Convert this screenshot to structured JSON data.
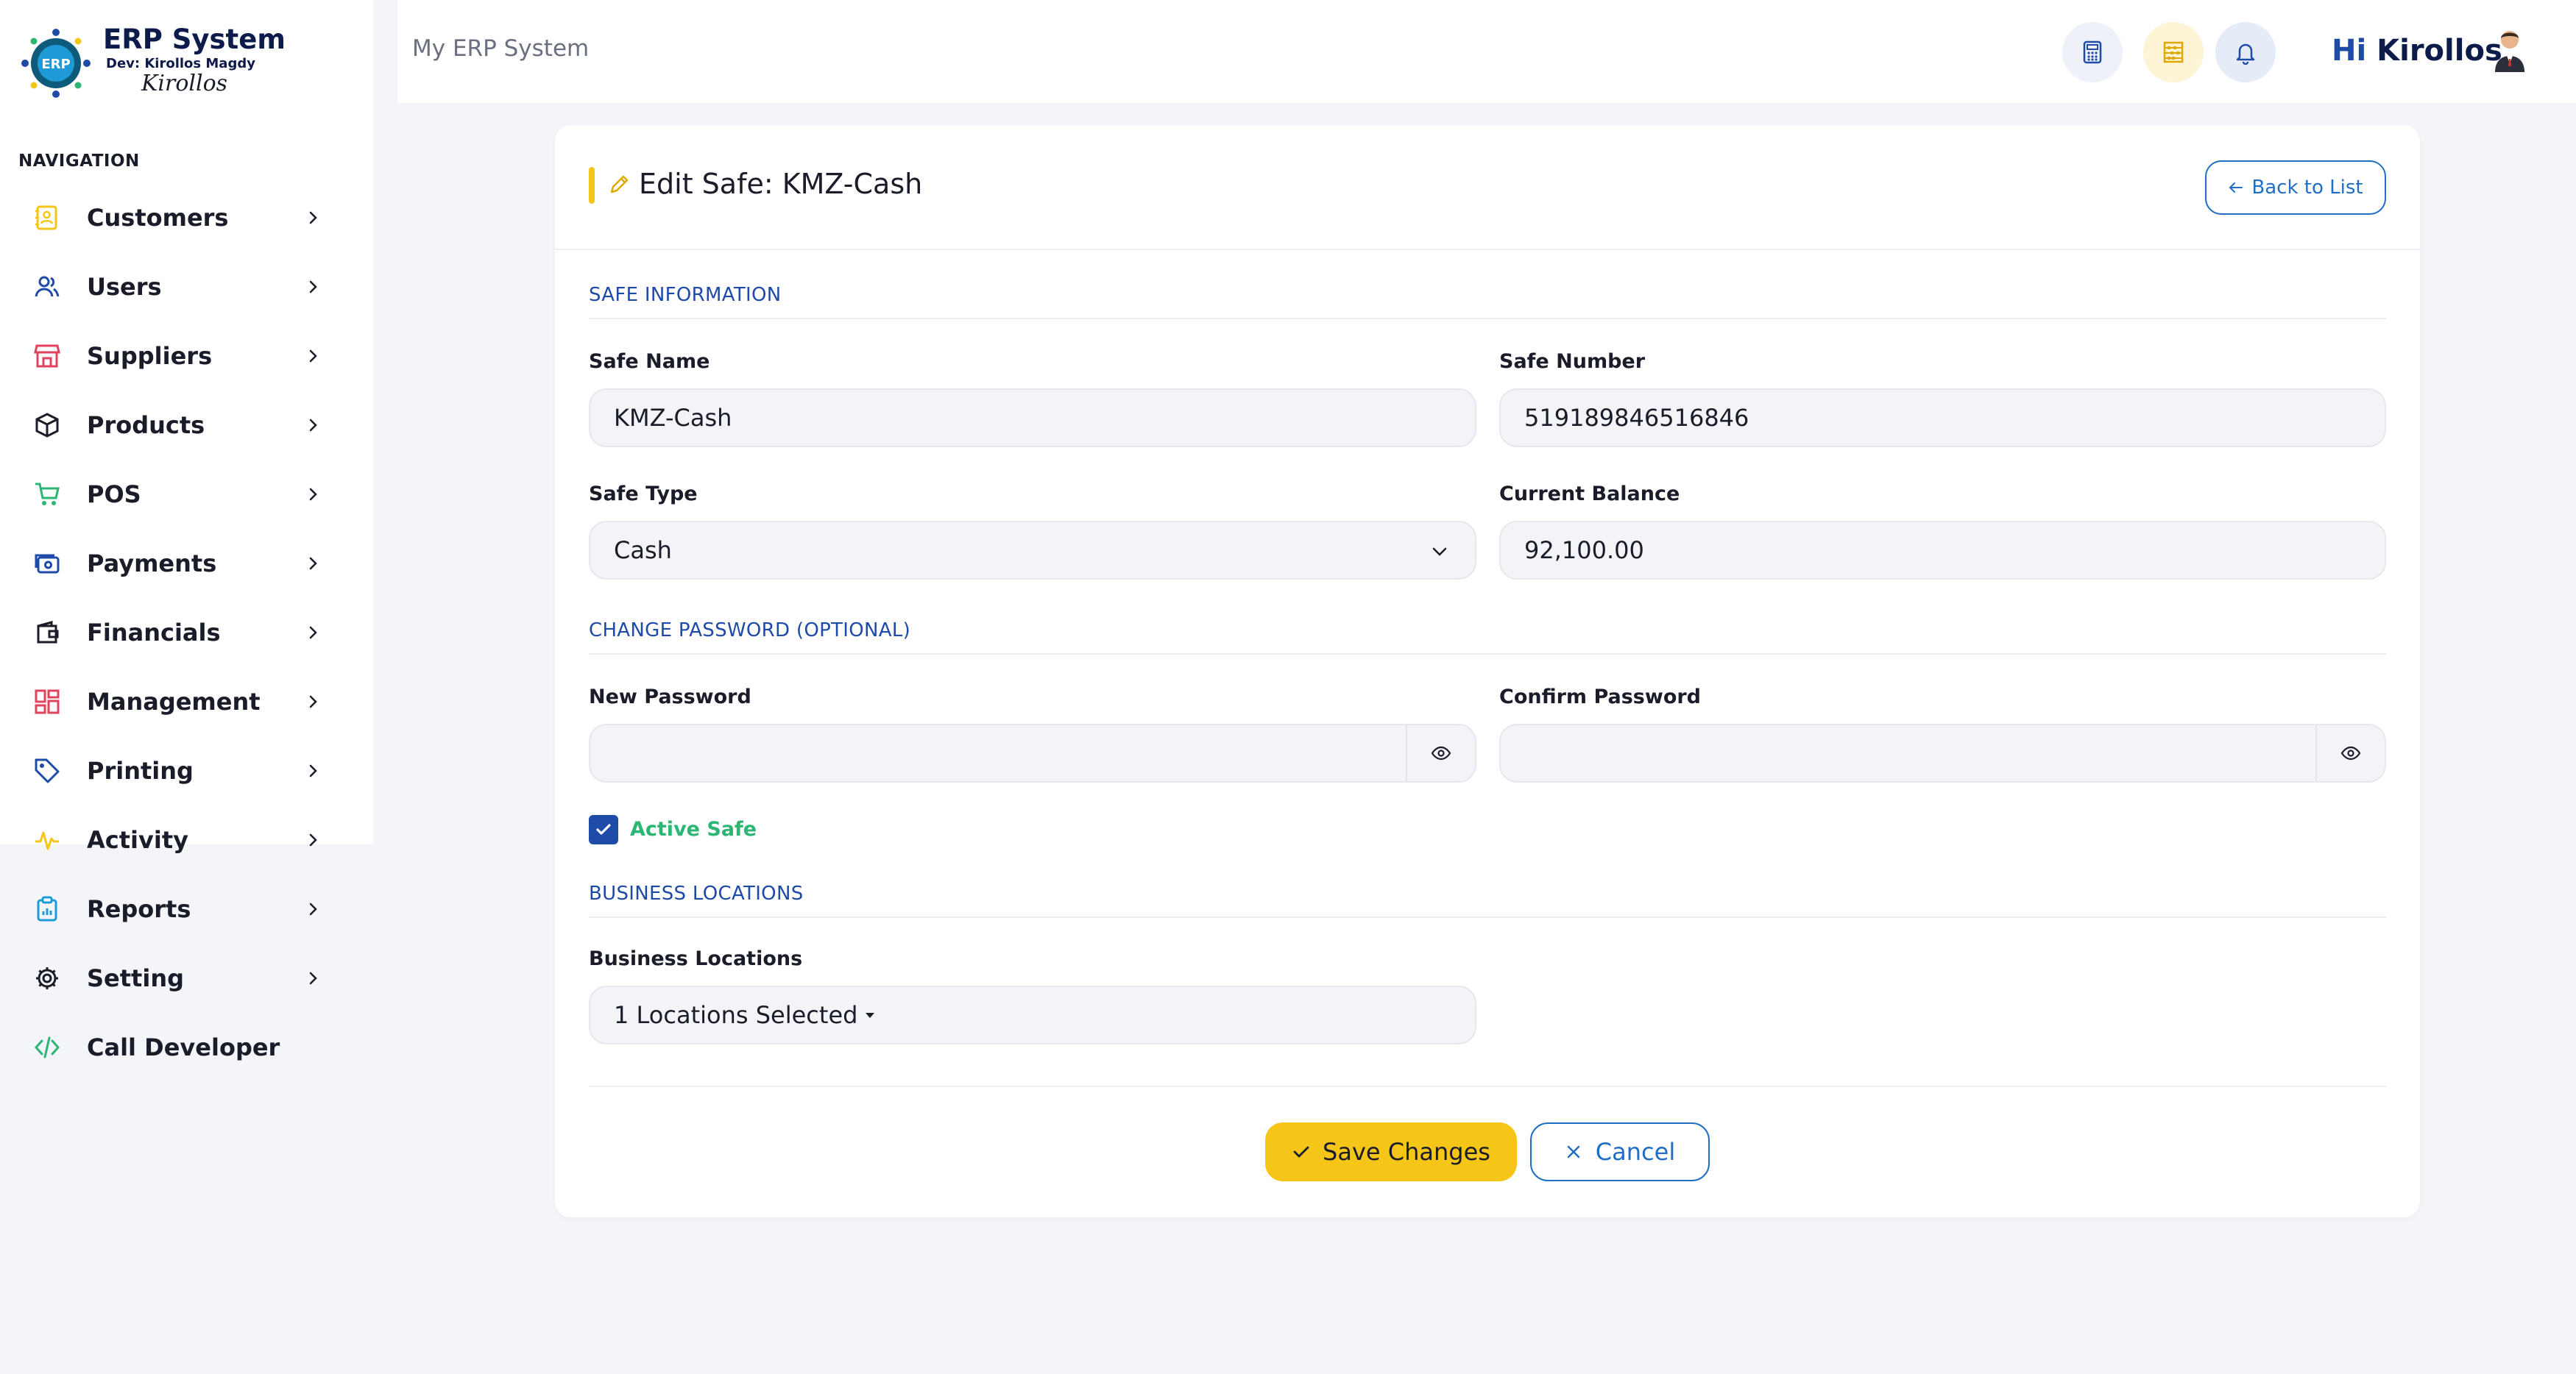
{
  "brand": {
    "title": "ERP System",
    "subtitle": "Dev: Kirollos Magdy",
    "signature": "Kirollos",
    "badge": "ERP"
  },
  "sidebar": {
    "heading": "NAVIGATION",
    "items": [
      {
        "label": "Customers",
        "icon": "address-book-icon",
        "color": "#f5c518",
        "has_chevron": true
      },
      {
        "label": "Users",
        "icon": "users-icon",
        "color": "#1e4aa8",
        "has_chevron": true
      },
      {
        "label": "Suppliers",
        "icon": "store-icon",
        "color": "#e0435c",
        "has_chevron": true
      },
      {
        "label": "Products",
        "icon": "box-icon",
        "color": "#1a1d29",
        "has_chevron": true
      },
      {
        "label": "POS",
        "icon": "cart-icon",
        "color": "#2bb673",
        "has_chevron": true
      },
      {
        "label": "Payments",
        "icon": "cash-icon",
        "color": "#1e4aa8",
        "has_chevron": true
      },
      {
        "label": "Financials",
        "icon": "wallet-icon",
        "color": "#1a1d29",
        "has_chevron": true
      },
      {
        "label": "Management",
        "icon": "grid-icon",
        "color": "#e0435c",
        "has_chevron": true
      },
      {
        "label": "Printing",
        "icon": "tag-icon",
        "color": "#1e4aa8",
        "has_chevron": true
      },
      {
        "label": "Activity",
        "icon": "pulse-icon",
        "color": "#f5c518",
        "has_chevron": true
      },
      {
        "label": "Reports",
        "icon": "clipboard-icon",
        "color": "#1e9ad6",
        "has_chevron": true
      },
      {
        "label": "Setting",
        "icon": "gear-icon",
        "color": "#1a1d29",
        "has_chevron": true
      },
      {
        "label": "Call Developer",
        "icon": "code-icon",
        "color": "#2bb673",
        "has_chevron": false
      }
    ]
  },
  "topbar": {
    "title": "My ERP System",
    "greeting_hi": "Hi",
    "greeting_name": "Kirollos",
    "buttons": [
      {
        "icon": "calculator-icon",
        "bg": "#eef1f8",
        "color": "#1e4aa8"
      },
      {
        "icon": "abacus-icon",
        "bg": "#fdf4d6",
        "color": "#e0a800"
      },
      {
        "icon": "bell-icon",
        "bg": "#e6ecf7",
        "color": "#1e4aa8"
      }
    ]
  },
  "form": {
    "title": "Edit Safe: KMZ-Cash",
    "back_label": "Back to List",
    "sections": {
      "safe_info": "SAFE INFORMATION",
      "password": "CHANGE PASSWORD (OPTIONAL)",
      "locations": "BUSINESS LOCATIONS"
    },
    "safe_name": {
      "label": "Safe Name",
      "value": "KMZ-Cash"
    },
    "safe_number": {
      "label": "Safe Number",
      "value": "519189846516846"
    },
    "safe_type": {
      "label": "Safe Type",
      "value": "Cash"
    },
    "current_balance": {
      "label": "Current Balance",
      "value": "92,100.00"
    },
    "new_password": {
      "label": "New Password",
      "value": ""
    },
    "confirm_password": {
      "label": "Confirm Password",
      "value": ""
    },
    "active_safe": {
      "label": "Active Safe",
      "checked": true
    },
    "business_locations": {
      "label": "Business Locations",
      "value": "1 Locations Selected"
    },
    "save_label": "Save Changes",
    "cancel_label": "Cancel"
  }
}
